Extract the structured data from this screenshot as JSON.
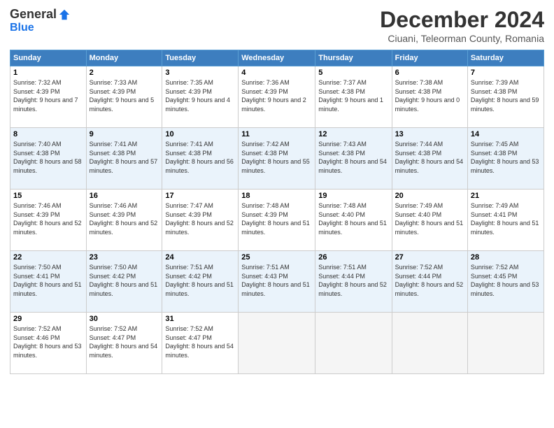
{
  "logo": {
    "general": "General",
    "blue": "Blue"
  },
  "title": "December 2024",
  "subtitle": "Ciuani, Teleorman County, Romania",
  "days_of_week": [
    "Sunday",
    "Monday",
    "Tuesday",
    "Wednesday",
    "Thursday",
    "Friday",
    "Saturday"
  ],
  "weeks": [
    [
      {
        "num": "1",
        "rise": "7:32 AM",
        "set": "4:39 PM",
        "hours": "9 hours and 7 minutes."
      },
      {
        "num": "2",
        "rise": "7:33 AM",
        "set": "4:39 PM",
        "hours": "9 hours and 5 minutes."
      },
      {
        "num": "3",
        "rise": "7:35 AM",
        "set": "4:39 PM",
        "hours": "9 hours and 4 minutes."
      },
      {
        "num": "4",
        "rise": "7:36 AM",
        "set": "4:39 PM",
        "hours": "9 hours and 2 minutes."
      },
      {
        "num": "5",
        "rise": "7:37 AM",
        "set": "4:38 PM",
        "hours": "9 hours and 1 minute."
      },
      {
        "num": "6",
        "rise": "7:38 AM",
        "set": "4:38 PM",
        "hours": "9 hours and 0 minutes."
      },
      {
        "num": "7",
        "rise": "7:39 AM",
        "set": "4:38 PM",
        "hours": "8 hours and 59 minutes."
      }
    ],
    [
      {
        "num": "8",
        "rise": "7:40 AM",
        "set": "4:38 PM",
        "hours": "8 hours and 58 minutes."
      },
      {
        "num": "9",
        "rise": "7:41 AM",
        "set": "4:38 PM",
        "hours": "8 hours and 57 minutes."
      },
      {
        "num": "10",
        "rise": "7:41 AM",
        "set": "4:38 PM",
        "hours": "8 hours and 56 minutes."
      },
      {
        "num": "11",
        "rise": "7:42 AM",
        "set": "4:38 PM",
        "hours": "8 hours and 55 minutes."
      },
      {
        "num": "12",
        "rise": "7:43 AM",
        "set": "4:38 PM",
        "hours": "8 hours and 54 minutes."
      },
      {
        "num": "13",
        "rise": "7:44 AM",
        "set": "4:38 PM",
        "hours": "8 hours and 54 minutes."
      },
      {
        "num": "14",
        "rise": "7:45 AM",
        "set": "4:38 PM",
        "hours": "8 hours and 53 minutes."
      }
    ],
    [
      {
        "num": "15",
        "rise": "7:46 AM",
        "set": "4:39 PM",
        "hours": "8 hours and 52 minutes."
      },
      {
        "num": "16",
        "rise": "7:46 AM",
        "set": "4:39 PM",
        "hours": "8 hours and 52 minutes."
      },
      {
        "num": "17",
        "rise": "7:47 AM",
        "set": "4:39 PM",
        "hours": "8 hours and 52 minutes."
      },
      {
        "num": "18",
        "rise": "7:48 AM",
        "set": "4:39 PM",
        "hours": "8 hours and 51 minutes."
      },
      {
        "num": "19",
        "rise": "7:48 AM",
        "set": "4:40 PM",
        "hours": "8 hours and 51 minutes."
      },
      {
        "num": "20",
        "rise": "7:49 AM",
        "set": "4:40 PM",
        "hours": "8 hours and 51 minutes."
      },
      {
        "num": "21",
        "rise": "7:49 AM",
        "set": "4:41 PM",
        "hours": "8 hours and 51 minutes."
      }
    ],
    [
      {
        "num": "22",
        "rise": "7:50 AM",
        "set": "4:41 PM",
        "hours": "8 hours and 51 minutes."
      },
      {
        "num": "23",
        "rise": "7:50 AM",
        "set": "4:42 PM",
        "hours": "8 hours and 51 minutes."
      },
      {
        "num": "24",
        "rise": "7:51 AM",
        "set": "4:42 PM",
        "hours": "8 hours and 51 minutes."
      },
      {
        "num": "25",
        "rise": "7:51 AM",
        "set": "4:43 PM",
        "hours": "8 hours and 51 minutes."
      },
      {
        "num": "26",
        "rise": "7:51 AM",
        "set": "4:44 PM",
        "hours": "8 hours and 52 minutes."
      },
      {
        "num": "27",
        "rise": "7:52 AM",
        "set": "4:44 PM",
        "hours": "8 hours and 52 minutes."
      },
      {
        "num": "28",
        "rise": "7:52 AM",
        "set": "4:45 PM",
        "hours": "8 hours and 53 minutes."
      }
    ],
    [
      {
        "num": "29",
        "rise": "7:52 AM",
        "set": "4:46 PM",
        "hours": "8 hours and 53 minutes."
      },
      {
        "num": "30",
        "rise": "7:52 AM",
        "set": "4:47 PM",
        "hours": "8 hours and 54 minutes."
      },
      {
        "num": "31",
        "rise": "7:52 AM",
        "set": "4:47 PM",
        "hours": "8 hours and 54 minutes."
      },
      null,
      null,
      null,
      null
    ]
  ]
}
